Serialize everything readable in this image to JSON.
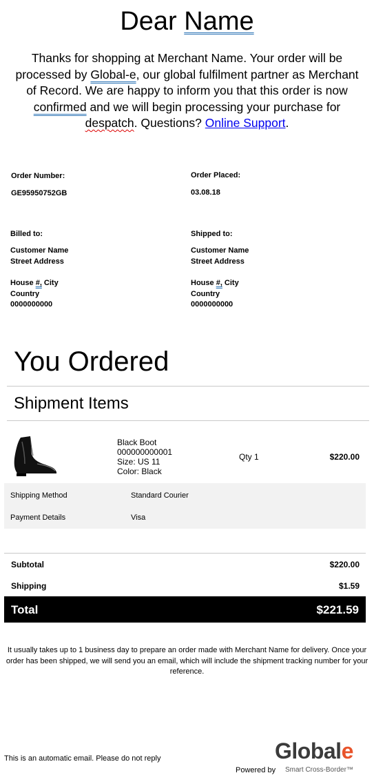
{
  "greeting": {
    "prefix": "Dear ",
    "name": "Name"
  },
  "intro": {
    "p1": "Thanks for shopping at Merchant Name. Your order will be processed by ",
    "global_e": "Global-e",
    "p2": ", our global fulfilment partner as Merchant of Record. We are happy to inform you that this order is now ",
    "confirmed": "confirmed",
    "p3": " and we will begin processing your purchase for ",
    "despatch": "despatch",
    "p4": ". Questions? ",
    "support_link": "Online Support",
    "p5": "."
  },
  "order": {
    "number_label": "Order Number:",
    "number": "GE95950752GB",
    "placed_label": "Order Placed:",
    "placed": "03.08.18"
  },
  "billed": {
    "label": "Billed to:",
    "name": "Customer Name",
    "street": "Street Address",
    "house_prefix": "House ",
    "house_hash": "#",
    "house_comma": ",",
    "house_suffix": " City",
    "country": "Country",
    "phone": "0000000000"
  },
  "shipped": {
    "label": "Shipped to:",
    "name": "Customer Name",
    "street": "Street Address",
    "house_prefix": "House ",
    "house_hash": "#",
    "house_comma": ",",
    "house_suffix": " City",
    "country": "Country",
    "phone": "0000000000"
  },
  "headings": {
    "you_ordered": "You Ordered",
    "shipment_items": "Shipment Items"
  },
  "item": {
    "name": "Black Boot",
    "sku": "000000000001",
    "size": "Size: US 11",
    "color": "Color: Black",
    "qty": "Qty 1",
    "price": "$220.00"
  },
  "details": {
    "shipping_method_label": "Shipping Method",
    "shipping_method": "Standard Courier",
    "payment_label": "Payment Details",
    "payment": "Visa"
  },
  "summary": {
    "subtotal_label": "Subtotal",
    "subtotal": "$220.00",
    "shipping_label": "Shipping",
    "shipping": "$1.59",
    "total_label": "Total",
    "total": "$221.59"
  },
  "footer": {
    "note": "It usually takes up to 1 business day to prepare an order made with Merchant Name for delivery. Once your order has been shipped, we will send you an email, which will include the shipment tracking number for your reference.",
    "auto_email": "This is an automatic email. Please do not reply",
    "powered_by": "Powered by",
    "logo_main": "Global",
    "logo_e": "e",
    "tagline": "Smart Cross-Border™"
  },
  "colors": {
    "link": "#0000ee",
    "logo_accent": "#e8542b",
    "total_bar": "#000000",
    "details_bg": "#f2f2f2"
  },
  "icons": {
    "product_image": "black-chelsea-boot"
  }
}
